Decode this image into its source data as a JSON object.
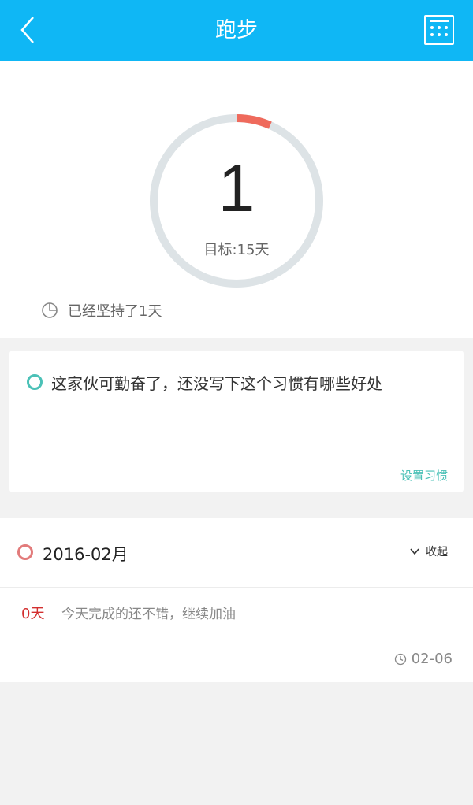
{
  "header": {
    "title": "跑步"
  },
  "progress": {
    "count": "1",
    "goal_label": "目标:15天",
    "completed_days": 1,
    "goal_days": 15,
    "streak_text": "已经坚持了1天"
  },
  "habit_card": {
    "description": "这家伙可勤奋了，还没写下这个习惯有哪些好处",
    "set_link": "设置习惯"
  },
  "month": {
    "title": "2016-02月",
    "collapse_label": "收起"
  },
  "entry": {
    "days": "0天",
    "text": "今天完成的还不错，继续加油",
    "date": "02-06"
  },
  "colors": {
    "header": "#0fb7f5",
    "ring_track": "#dde3e6",
    "ring_progress": "#ef6a5c",
    "accent_teal": "#4bc1b7",
    "month_dot": "#e27b7b",
    "days_red": "#d32f2f"
  }
}
